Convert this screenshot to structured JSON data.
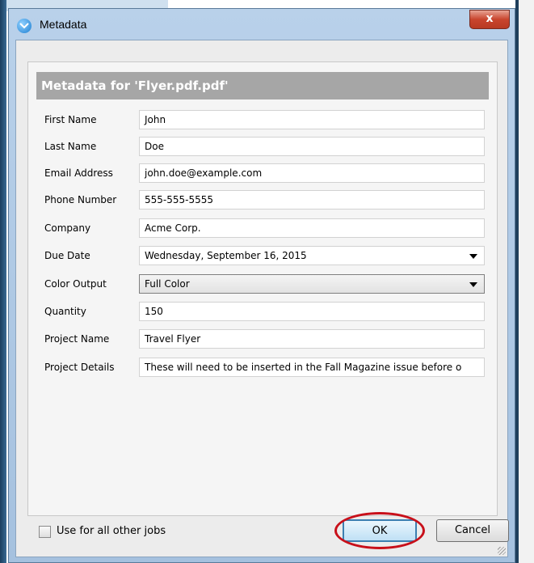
{
  "window": {
    "title": "Metadata",
    "close_glyph": "x"
  },
  "header": {
    "title": "Metadata for 'Flyer.pdf.pdf'"
  },
  "fields": [
    {
      "label": "First Name",
      "value": "John",
      "type": "text"
    },
    {
      "label": "Last Name",
      "value": "Doe",
      "type": "text"
    },
    {
      "label": "Email Address",
      "value": "john.doe@example.com",
      "type": "text"
    },
    {
      "label": "Phone Number",
      "value": "555-555-5555",
      "type": "text"
    },
    {
      "label": "Company",
      "value": "Acme Corp.",
      "type": "text"
    },
    {
      "label": "Due Date",
      "value": "Wednesday, September 16, 2015",
      "type": "date-picker"
    },
    {
      "label": "Color Output",
      "value": "Full Color",
      "type": "dropdown"
    },
    {
      "label": "Quantity",
      "value": "150",
      "type": "text"
    },
    {
      "label": "Project Name",
      "value": "Travel Flyer",
      "type": "text"
    },
    {
      "label": "Project Details",
      "value": "These will need to be inserted in the Fall Magazine issue before o",
      "type": "text"
    }
  ],
  "footer": {
    "checkbox_label": "Use for all other jobs",
    "checkbox_checked": false,
    "ok_label": "OK",
    "cancel_label": "Cancel"
  },
  "colors": {
    "highlight_ring": "#c8101a",
    "header_bg": "#a6a6a6",
    "titlebar": "#b9d1ea"
  }
}
